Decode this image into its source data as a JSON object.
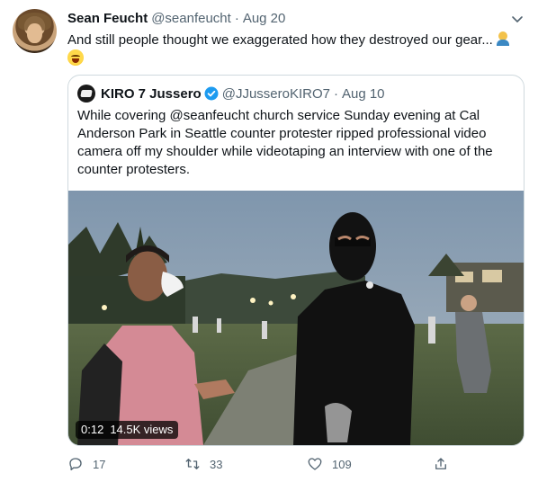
{
  "tweet": {
    "author_name": "Sean Feucht",
    "author_handle": "@seanfeucht",
    "separator": "·",
    "time": "Aug 20",
    "text": "And still people thought we exaggerated how they destroyed our gear..."
  },
  "quote": {
    "author_name": "KIRO 7 Jussero",
    "author_handle": "@JJusseroKIRO7",
    "separator": "·",
    "time": "Aug 10",
    "text": "While covering @seanfeucht church service Sunday evening at Cal Anderson Park in Seattle counter protester ripped professional video camera off my shoulder while videotaping an interview with one of the counter protesters.",
    "video": {
      "duration": "0:12",
      "views": "14.5K views"
    }
  },
  "actions": {
    "replies": "17",
    "retweets": "33",
    "likes": "109"
  },
  "colors": {
    "text_primary": "#0f1419",
    "text_secondary": "#536471",
    "verified": "#1d9bf0",
    "border": "#cfd9de"
  },
  "icons": [
    "chevron-down-icon",
    "verified-badge-icon",
    "reply-icon",
    "retweet-icon",
    "like-icon",
    "share-icon",
    "facepalm-emoji",
    "zany-face-emoji"
  ]
}
